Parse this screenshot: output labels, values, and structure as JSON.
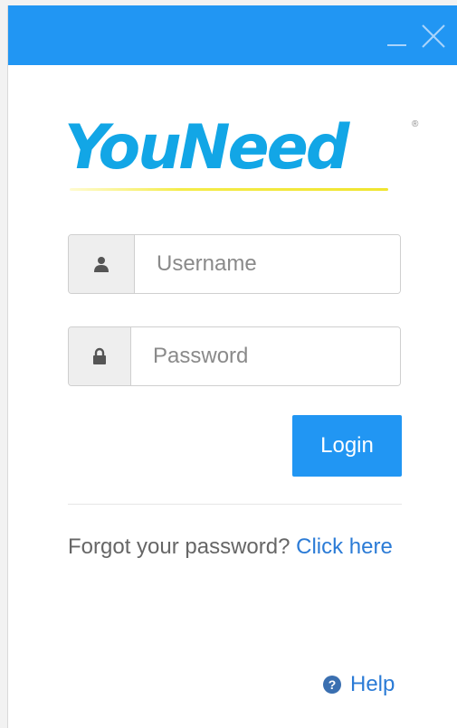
{
  "titlebar": {
    "color": "#2196f3"
  },
  "logo": {
    "text": "YouNeed",
    "mark": "®",
    "color": "#12a6e6"
  },
  "form": {
    "username_placeholder": "Username",
    "username_value": "",
    "password_placeholder": "Password",
    "password_value": "",
    "username_icon": "user-icon",
    "password_icon": "lock-icon",
    "login_label": "Login"
  },
  "footer": {
    "forgot_text": "Forgot your password?",
    "forgot_link": "Click here",
    "help_label": "Help",
    "help_icon": "question-circle-icon"
  }
}
